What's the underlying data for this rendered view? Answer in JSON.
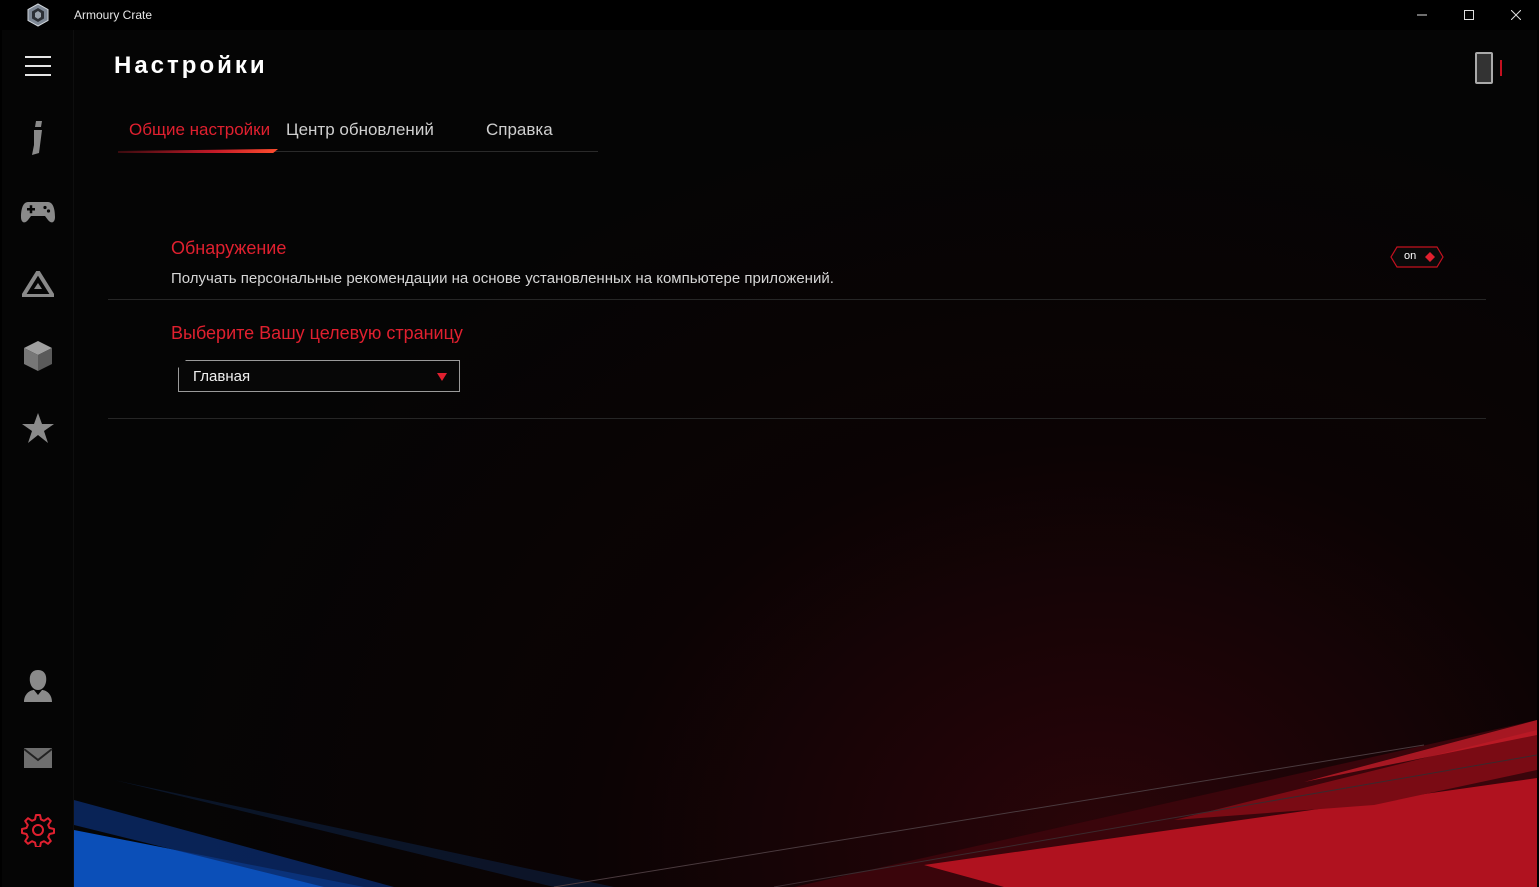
{
  "window": {
    "title": "Armoury Crate",
    "controls": [
      "minimize",
      "maximize",
      "close"
    ]
  },
  "sidebar": {
    "items": [
      {
        "name": "menu",
        "icon": "hamburger-icon"
      },
      {
        "name": "device",
        "icon": "device-info-icon"
      },
      {
        "name": "game-library",
        "icon": "gamepad-icon"
      },
      {
        "name": "aura",
        "icon": "aura-triangle-icon"
      },
      {
        "name": "scenario",
        "icon": "cube-icon"
      },
      {
        "name": "featured",
        "icon": "star-icon"
      },
      {
        "name": "account",
        "icon": "user-icon"
      },
      {
        "name": "news",
        "icon": "mail-icon"
      },
      {
        "name": "settings",
        "icon": "gear-icon",
        "active": true
      }
    ]
  },
  "page": {
    "title": "Настройки"
  },
  "tabs": [
    {
      "label": "Общие настройки",
      "active": true
    },
    {
      "label": "Центр обновлений",
      "active": false
    },
    {
      "label": "Справка",
      "active": false
    }
  ],
  "settings": {
    "discovery": {
      "title": "Обнаружение",
      "description": "Получать персональные рекомендации на основе установленных на компьютере приложений.",
      "toggle_label": "on",
      "enabled": true
    },
    "landing_page": {
      "title": "Выберите Вашу целевую страницу",
      "selected": "Главная"
    }
  },
  "colors": {
    "accent": "#e0202f",
    "background": "#050505",
    "text": "#d6d6d6"
  }
}
